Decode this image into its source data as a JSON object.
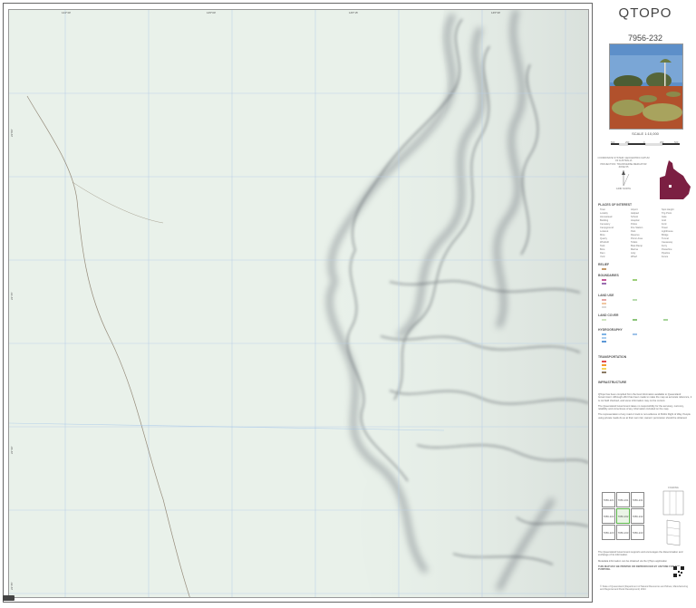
{
  "title": "QTOPO",
  "sheet_number": "7956-232",
  "scale_text": "SCALE 1:10,000",
  "scale_ticks": [
    "500",
    "250",
    "0",
    "250",
    "500"
  ],
  "scale_unit": "metres",
  "projection_lines": [
    "COORDINATE SYSTEM: GEOCENTRIC DATUM OF AUSTRALIA",
    "PROJECTION: TRANSVERSE MERCATOR",
    "ZONE 55"
  ],
  "grid_note": "GRID NORTH",
  "legend": {
    "places": "PLACES OF INTEREST",
    "boundaries": "BOUNDARIES",
    "land_use": "LAND USE",
    "land_cover": "LAND COVER",
    "hydrography": "HYDROGRAPHY",
    "transport": "TRANSPORTATION",
    "infrastructure": "INFRASTRUCTURE",
    "relief": "RELIEF",
    "items_a": [
      "Town",
      "Locality",
      "Homestead",
      "Building",
      "Cemetery",
      "Campground",
      "Lookout",
      "Mine",
      "Quarry",
      "Windmill",
      "Tank",
      "Bore",
      "Dam",
      "Yard"
    ],
    "items_b": [
      "Airport",
      "Helipad",
      "School",
      "Hospital",
      "Police",
      "Fire Station",
      "Park",
      "Reserve",
      "Picnic Area",
      "Toilets",
      "Boat Ramp",
      "Marina",
      "Jetty",
      "Wharf"
    ],
    "items_c": [
      "Spot Height",
      "Trig Point",
      "Gate",
      "Grid",
      "Ford",
      "Tower",
      "Lighthouse",
      "Bridge",
      "Tunnel",
      "Causeway",
      "Ferry",
      "Powerline",
      "Pipeline",
      "Fence"
    ]
  },
  "notes": [
    "QTopo has been compiled from the best information available to Queensland Government. Although effort has been made to make the map as accurate reference, it is not field checked, and some information may not be current.",
    "The Queensland Government takes no responsibility for the accuracy, currency, reliability and correctness of any information included on the map.",
    "The representation of any road or track is not evidence of Public Right of Way. People using private roads do so at their own risk; owners' permission should be obtained."
  ],
  "index_sheets": [
    "7956-221",
    "7956-231",
    "7956-241",
    "7956-222",
    "7956-232",
    "7956-242",
    "7956-223",
    "7956-233",
    "7956-243"
  ],
  "fold_label": "FOLDING",
  "bottom_notes": [
    "The Queensland Government supports and encourages the dissemination and exchange of its information.",
    "Metadata information can be obtained via the QTopo application",
    "THIS MAP MAY BE PRINTED OR REPRODUCED BY ANYONE FOR ANY PURPOSE."
  ],
  "state_credit": "© State of Queensland (Department of Natural Resources and Mines, Manufacturing and Regional and Rural Development) 2024",
  "coords_top": [
    "144°30'",
    "145°00'",
    "145°15'",
    "145°30'"
  ],
  "coords_left": [
    "22°00'",
    "22°15'",
    "22°30'",
    "22°45'"
  ],
  "colors": {
    "map_bg": "#e6efe8",
    "relief": "#5a5f66",
    "grid": "#b7cde7",
    "track": "#7a6a55",
    "roo": "#9fc3e9"
  }
}
